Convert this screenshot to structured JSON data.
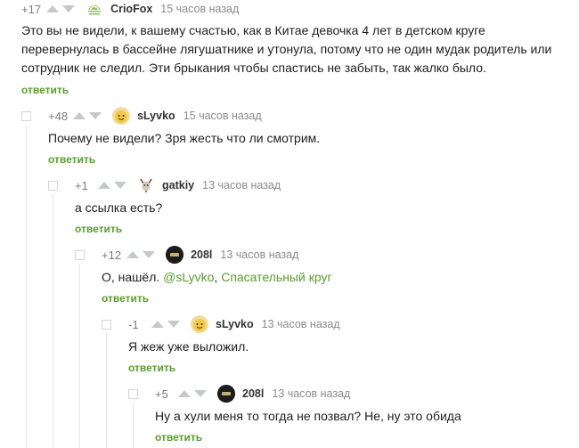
{
  "comments": [
    {
      "rating": "+17",
      "author": "CrioFox",
      "time": "15 часов назад",
      "text_lines": [
        "Это вы не видели, к вашему счастью, как в Китае девочка 4 лет в детском круге",
        "перевернулась в бассейне лягушатнике и утонула, потому что не один мудак родитель или",
        "сотрудник не следил. Эти брыкания чтобы спастись не забыть, так жалко было."
      ],
      "reply": "ответить"
    },
    {
      "rating": "+48",
      "author": "sLyvko",
      "time": "15 часов назад",
      "text": "Почему не видели? Зря жесть что ли смотрим.",
      "reply": "ответить"
    },
    {
      "rating": "+1",
      "author": "gatkiy",
      "time": "13 часов назад",
      "text": "а ссылка есть?",
      "reply": "ответить"
    },
    {
      "rating": "+12",
      "author": "208l",
      "time": "13 часов назад",
      "text_prefix": "О, нашёл. ",
      "mention": "@sLyvko",
      "separator": ", ",
      "link": "Спасательный круг",
      "reply": "ответить"
    },
    {
      "rating": "-1",
      "author": "sLyvko",
      "time": "13 часов назад",
      "text": "Я жеж уже выложил.",
      "reply": "ответить"
    },
    {
      "rating": "+5",
      "author": "208l",
      "time": "13 часов назад",
      "text": "Ну а хули меня то тогда не позвал? Не, ну это обида",
      "reply": "ответить"
    }
  ],
  "colors": {
    "accent": "#5a9e2e",
    "muted": "#8b8b8b",
    "arrow": "#c5c9cc"
  }
}
